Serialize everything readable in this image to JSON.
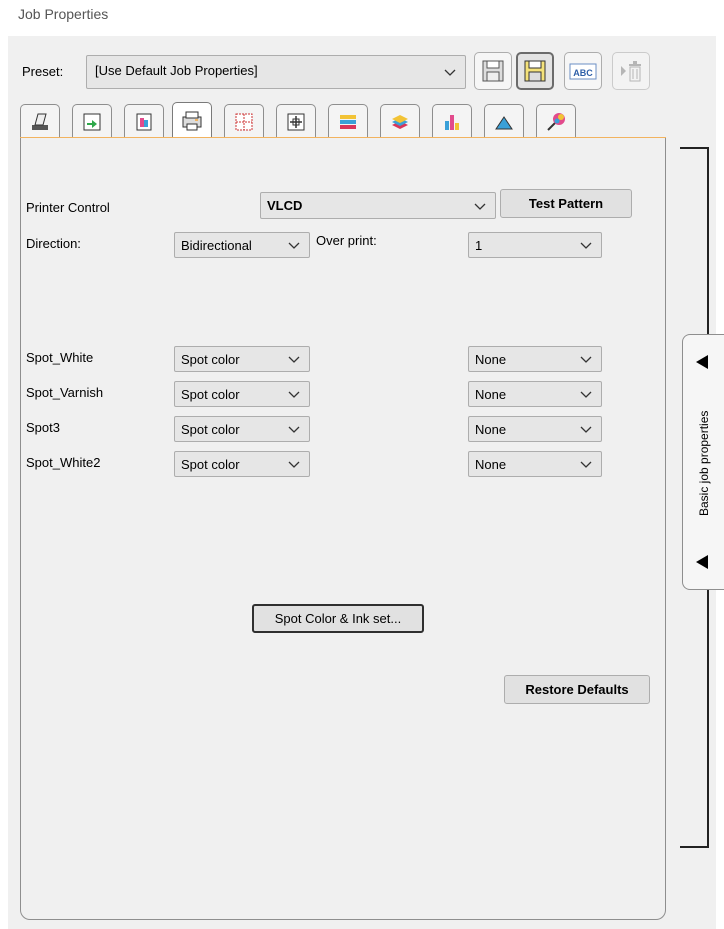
{
  "window": {
    "title": "Job Properties"
  },
  "preset": {
    "label": "Preset:",
    "value": "[Use Default Job Properties]",
    "toolbar_icons": [
      "save-preset-icon",
      "save-as-preset-icon",
      "rename-preset-icon",
      "delete-preset-icon"
    ]
  },
  "tabs": {
    "active_index": 3,
    "icons": [
      "media-icon",
      "layout-icon",
      "color-management-icon",
      "printer-icon",
      "tiling-icon",
      "transform-icon",
      "layer-icon",
      "ink-stack-icon",
      "color-bars-icon",
      "cutting-icon",
      "color-picker-icon"
    ]
  },
  "printer": {
    "control_label": "Printer Control",
    "control_value": "VLCD",
    "test_pattern_label": "Test Pattern",
    "direction_label": "Direction:",
    "direction_value": "Bidirectional",
    "overprint_label": "Over print:",
    "overprint_value": "1"
  },
  "spots": [
    {
      "name": "Spot_White",
      "mode": "Spot color",
      "option": "None"
    },
    {
      "name": "Spot_Varnish",
      "mode": "Spot color",
      "option": "None"
    },
    {
      "name": "Spot3",
      "mode": "Spot color",
      "option": "None"
    },
    {
      "name": "Spot_White2",
      "mode": "Spot color",
      "option": "None"
    }
  ],
  "buttons": {
    "spot_ink_set": "Spot Color & Ink set...",
    "restore_defaults": "Restore Defaults"
  },
  "side_tab": {
    "label": "Basic job properties"
  },
  "colors": {
    "active_tab_accent": "#f2b35f",
    "panel_bg": "#f0f0f0"
  }
}
